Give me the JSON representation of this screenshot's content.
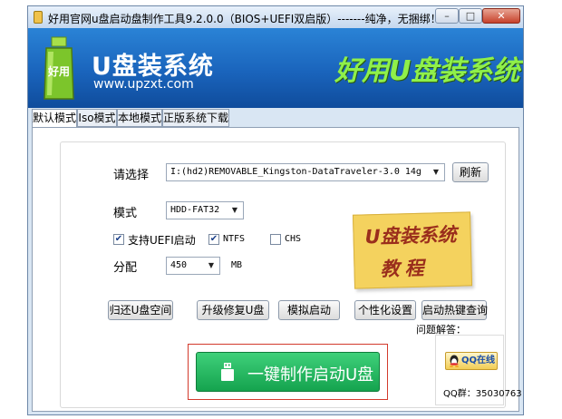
{
  "window": {
    "title": "好用官网u盘启动盘制作工具9.2.0.0（BIOS+UEFI双启版）-------纯净，无捆绑！",
    "minimize_glyph": "–",
    "maximize_glyph": "□",
    "close_glyph": "✕"
  },
  "banner": {
    "logo_text": "好用",
    "brand_name": "U盘装系统",
    "brand_url": "www.upzxt.com",
    "slogan": "好用U盘装系统"
  },
  "tabs": [
    {
      "label": "默认模式",
      "active": true
    },
    {
      "label": "Iso模式",
      "active": false
    },
    {
      "label": "本地模式",
      "active": false
    },
    {
      "label": "正版系统下载",
      "active": false
    }
  ],
  "form": {
    "select_label": "请选择",
    "device_value": "I:(hd2)REMOVABLE_Kingston-DataTraveler-3.0 14g",
    "refresh_label": "刷新",
    "mode_label": "模式",
    "mode_value": "HDD-FAT32",
    "uefi_label": "支持UEFI启动",
    "uefi_checked": true,
    "ntfs_label": "NTFS",
    "ntfs_checked": true,
    "chs_label": "CHS",
    "chs_checked": false,
    "alloc_label": "分配",
    "alloc_value": "450",
    "alloc_unit": "MB"
  },
  "note": {
    "line1": "U盘装系统",
    "line2": "教程"
  },
  "actions": [
    {
      "label": "归还U盘空间"
    },
    {
      "label": "升级修复U盘"
    },
    {
      "label": "模拟启动"
    },
    {
      "label": "个性化设置"
    },
    {
      "label": "启动热键查询"
    }
  ],
  "primary": {
    "label": "一键制作启动U盘"
  },
  "help": {
    "title": "问题解答：",
    "qq_label": "QQ在线",
    "qq_group": "QQ群：35030763"
  },
  "colors": {
    "banner": "#1a64bc",
    "slogan": "#8ff04a",
    "primary_button": "#15a34e",
    "highlight_frame": "#d33a2c",
    "note": "#f4d25e"
  },
  "icons": {
    "title": "app-icon",
    "logo": "bottle-logo-icon",
    "usb": "usb-drive-icon",
    "qq": "qq-penguin-icon"
  }
}
